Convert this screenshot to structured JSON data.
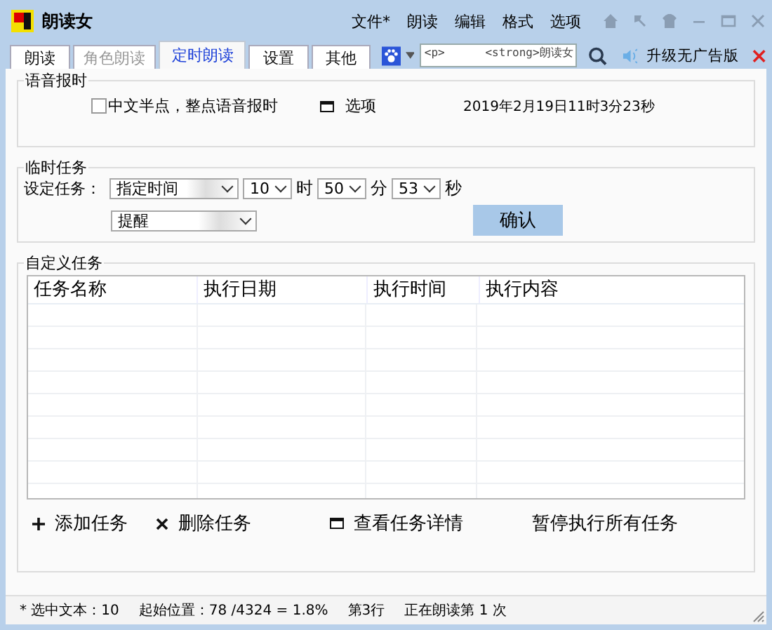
{
  "window": {
    "title": "朗读女",
    "menu": [
      "文件*",
      "朗读",
      "编辑",
      "格式",
      "选项"
    ]
  },
  "tabs": [
    {
      "label": "朗读",
      "selected": false,
      "disabled": false
    },
    {
      "label": "角色朗读",
      "selected": false,
      "disabled": true
    },
    {
      "label": "定时朗读",
      "selected": true,
      "disabled": false
    },
    {
      "label": "设置",
      "selected": false,
      "disabled": false
    },
    {
      "label": "其他",
      "selected": false,
      "disabled": false
    }
  ],
  "toolbar": {
    "input_value": "<p>      <strong>朗读女",
    "upgrade": "升级无广告版"
  },
  "voice_time": {
    "title": "语音报时",
    "checkbox": {
      "label": "中文半点，整点语音报时",
      "checked": false
    },
    "options": "选项",
    "datetime": "2019年2月19日11时3分23秒"
  },
  "temp_task": {
    "title": "临时任务",
    "label": "设定任务：",
    "row": [
      {
        "kind": "select",
        "value": "指定时间"
      },
      {
        "kind": "select",
        "value": "10"
      },
      {
        "kind": "unit",
        "text": "时"
      },
      {
        "kind": "select",
        "value": "50"
      },
      {
        "kind": "unit",
        "text": "分"
      },
      {
        "kind": "select",
        "value": "53"
      },
      {
        "kind": "unit",
        "text": "秒"
      }
    ],
    "action": "提醒",
    "confirm": "确认"
  },
  "custom_tasks": {
    "title": "自定义任务",
    "table": {
      "columns": [
        "任务名称",
        "执行日期",
        "执行时间",
        "执行内容"
      ]
    },
    "actions": [
      {
        "kind": "plus",
        "label": "添加任务"
      },
      {
        "kind": "cross",
        "label": "删除任务"
      },
      {
        "kind": "window",
        "label": "查看任务详情"
      },
      {
        "kind": "plain",
        "label": "暂停执行所有任务"
      }
    ]
  },
  "status_bar": [
    "* 选中文本：10",
    "起始位置：78 /4324 = 1.8%",
    "第3行",
    "正在朗读第 1 次"
  ]
}
